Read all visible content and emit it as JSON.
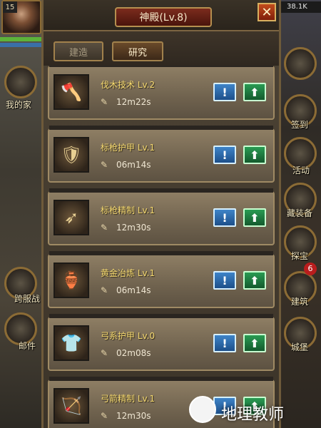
{
  "player": {
    "level": "15",
    "resource": "38.1K"
  },
  "title": "神殿(Lv.8)",
  "close_label": "✕",
  "tabs": [
    {
      "label": "建造"
    },
    {
      "label": "研究"
    }
  ],
  "side_left": [
    {
      "label": "我的家"
    },
    {
      "label": "跨服战"
    },
    {
      "label": "邮件"
    }
  ],
  "side_right": [
    {
      "label": "签到"
    },
    {
      "label": "活动"
    },
    {
      "label": "藏装备"
    },
    {
      "label": "探宝"
    },
    {
      "label": "建筑"
    },
    {
      "label": "城堡"
    }
  ],
  "notification_count": "6",
  "items": [
    {
      "name": "伐木技术 Lv.2",
      "time": "12m22s",
      "icon": "axe-icon",
      "glyph": "🪓"
    },
    {
      "name": "标枪护甲 Lv.1",
      "time": "06m14s",
      "icon": "shield-icon",
      "glyph": "🛡"
    },
    {
      "name": "标枪精制 Lv.1",
      "time": "12m30s",
      "icon": "javelin-icon",
      "glyph": "➶"
    },
    {
      "name": "黄金冶炼 Lv.1",
      "time": "06m14s",
      "icon": "gold-icon",
      "glyph": "🏺"
    },
    {
      "name": "弓系护甲 Lv.0",
      "time": "02m08s",
      "icon": "armor-icon",
      "glyph": "👕"
    },
    {
      "name": "弓箭精制 Lv.1",
      "time": "12m30s",
      "icon": "arrows-icon",
      "glyph": "🏹"
    }
  ],
  "info_label": "!",
  "upgrade_label": "⬆",
  "scroll_glyph": "✎",
  "watermark": "地理教师"
}
